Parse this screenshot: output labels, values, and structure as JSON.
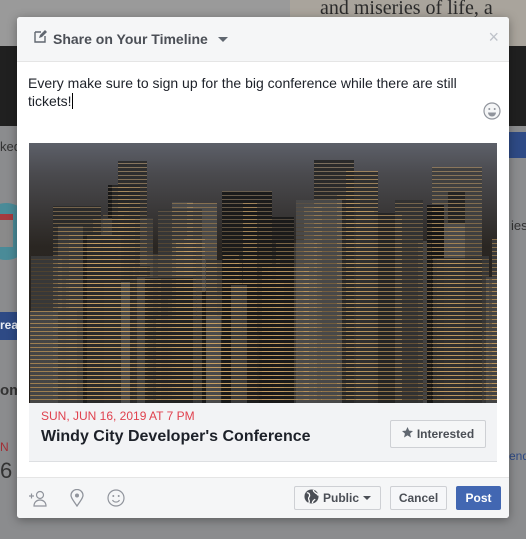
{
  "background": {
    "top_right_text": "and miseries of life, a",
    "fragments": [
      "ked",
      "ies",
      "rea",
      "om",
      "N",
      "6",
      "end"
    ]
  },
  "dialog": {
    "title": "Share on Your Timeline",
    "close_label": "×",
    "compose_text": "Every make sure to sign up for the big conference while there are still tickets!",
    "event": {
      "date": "SUN, JUN 16, 2019 AT 7 PM",
      "name": "Windy City Developer's Conference",
      "interested_label": "Interested",
      "date_color": "#e0414e"
    },
    "footer": {
      "audience": "Public",
      "cancel_label": "Cancel",
      "post_label": "Post",
      "post_color": "#4267b2"
    }
  }
}
